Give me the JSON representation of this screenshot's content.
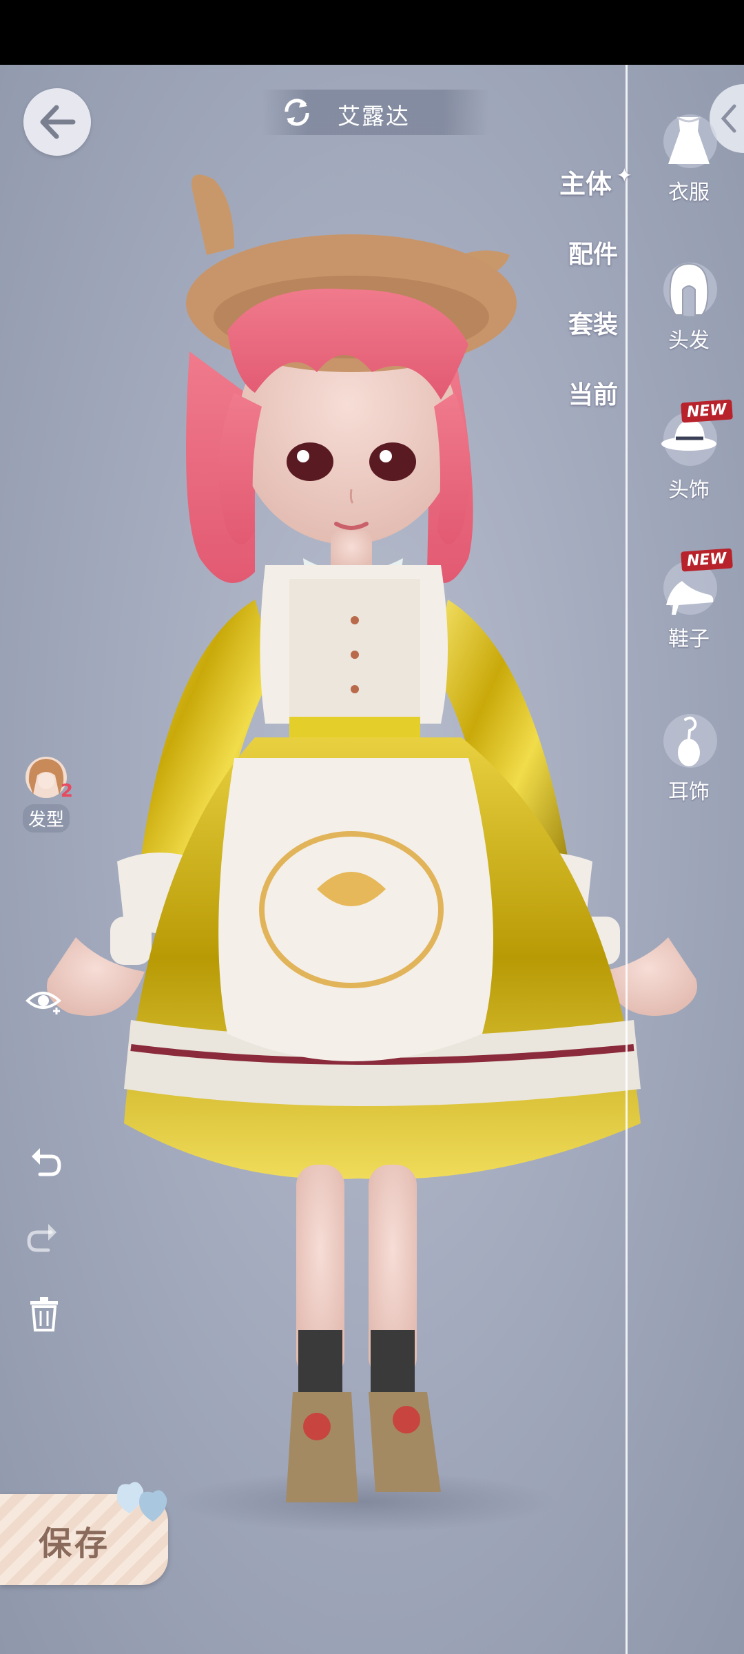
{
  "character_name": "艾露达",
  "subtabs": [
    "主体",
    "配件",
    "套装",
    "当前"
  ],
  "active_subtab": "主体",
  "categories": [
    {
      "label": "衣服",
      "icon": "dress-icon",
      "badge": ""
    },
    {
      "label": "头发",
      "icon": "hair-icon",
      "badge": ""
    },
    {
      "label": "头饰",
      "icon": "hat-icon",
      "badge": "NEW"
    },
    {
      "label": "鞋子",
      "icon": "shoe-icon",
      "badge": "NEW"
    },
    {
      "label": "耳饰",
      "icon": "earring-icon",
      "badge": ""
    }
  ],
  "left_tools": {
    "hairstyle_label": "发型",
    "hairstyle_count": "2"
  },
  "save_label": "保存",
  "colors": {
    "background": "#a4abbe",
    "new_badge": "#b8232b",
    "save_text": "#8a6a5a",
    "dress_gold": "#d4b80a"
  }
}
